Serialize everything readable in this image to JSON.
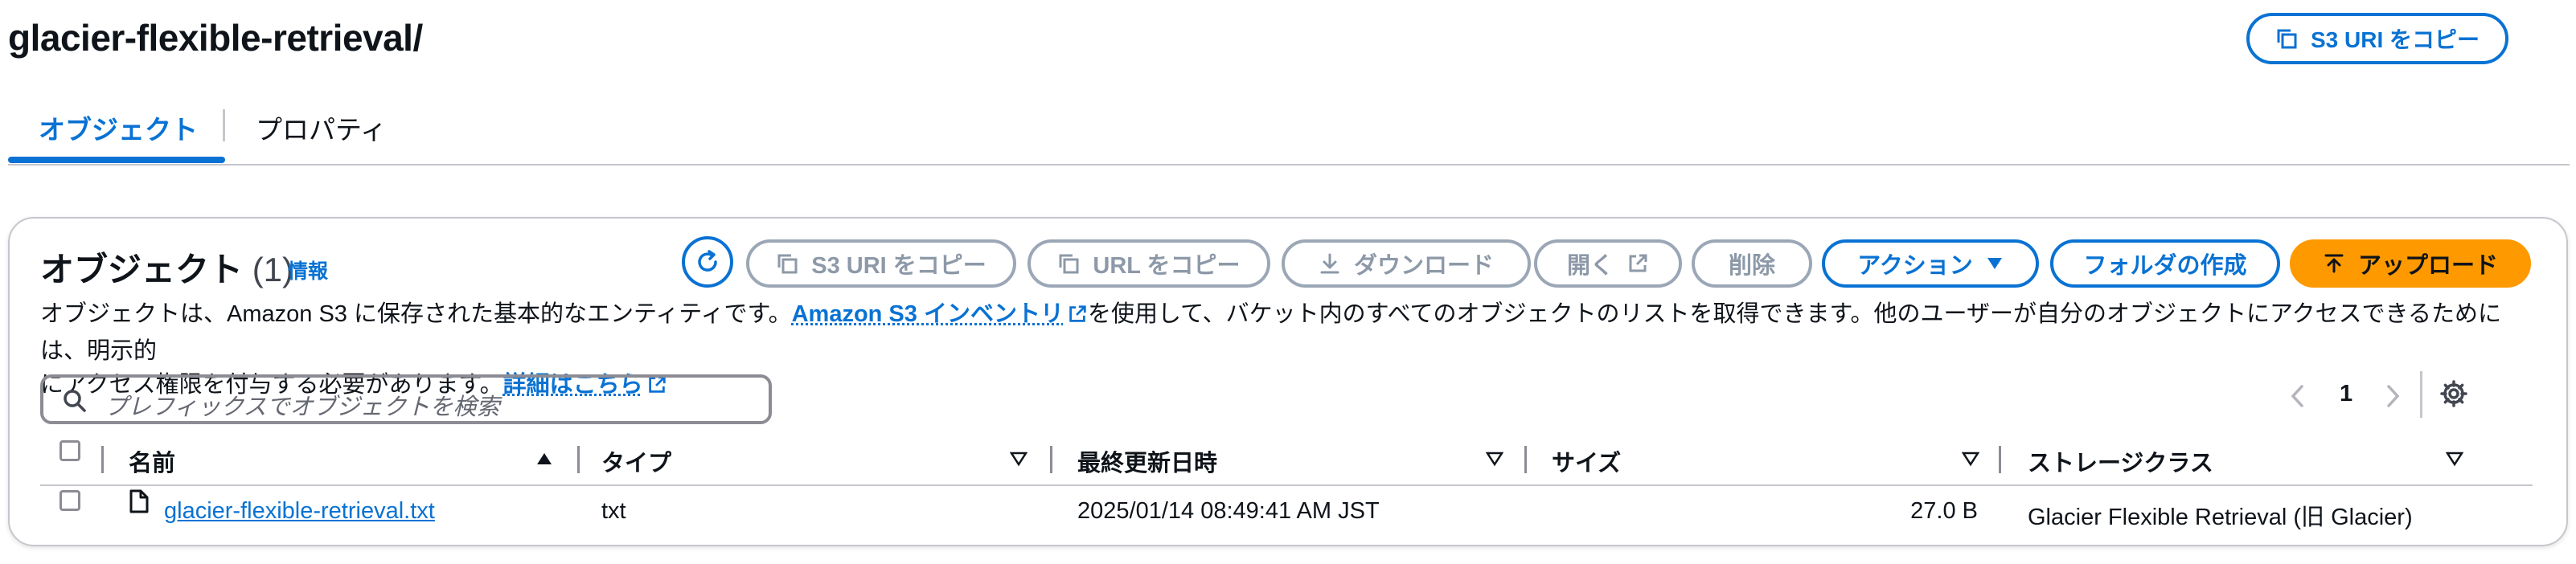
{
  "header": {
    "title": "glacier-flexible-retrieval/",
    "copy_s3_uri_label": "S3 URI をコピー"
  },
  "tabs": [
    {
      "label": "オブジェクト",
      "active": true
    },
    {
      "label": "プロパティ",
      "active": false
    }
  ],
  "panel": {
    "title": "オブジェクト",
    "count": "(1)",
    "info_link": "情報",
    "toolbar": {
      "refresh_icon": "refresh-icon",
      "copy_s3_uri": "S3 URI をコピー",
      "copy_url": "URL をコピー",
      "download": "ダウンロード",
      "open": "開く",
      "delete": "削除",
      "actions": "アクション",
      "create_folder": "フォルダの作成",
      "upload": "アップロード"
    },
    "description": {
      "part1": "オブジェクトは、Amazon S3 に保存された基本的なエンティティです。",
      "inventory_link": "Amazon S3 インベントリ",
      "part2": "を使用して、バケット内のすべてのオブジェクトのリストを取得できます。他のユーザーが自分のオブジェクトにアクセスできるためには、明示的",
      "part3": "にアクセス権限を付与する必要があります。",
      "details_link": "詳細はこちら"
    },
    "search": {
      "placeholder": "プレフィックスでオブジェクトを検索"
    },
    "pagination": {
      "current_page": "1"
    },
    "columns": [
      "名前",
      "タイプ",
      "最終更新日時",
      "サイズ",
      "ストレージクラス"
    ],
    "rows": [
      {
        "name": "glacier-flexible-retrieval.txt",
        "type": "txt",
        "last_modified": "2025/01/14 08:49:41 AM JST",
        "size": "27.0 B",
        "storage_class": "Glacier Flexible Retrieval (旧 Glacier)"
      }
    ]
  },
  "colors": {
    "accent": "#0972d3",
    "primary_button": "#ff9900",
    "disabled": "#9ba7b6"
  }
}
